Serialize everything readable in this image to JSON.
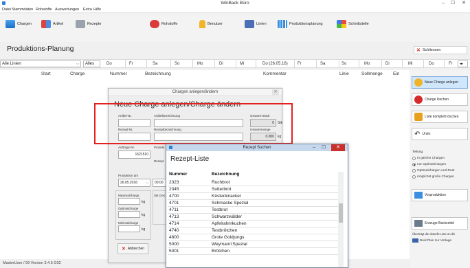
{
  "window": {
    "title": "WinBack Büro",
    "controls": [
      "–",
      "☐",
      "✕"
    ]
  },
  "menu": [
    "Datei",
    "Stammdaten",
    "Rohstoffe",
    "Auswertungen",
    "Extra",
    "Hilfe"
  ],
  "toolbar": [
    {
      "label": "Chargen",
      "icon": "chargen-icon"
    },
    {
      "label": "Artikel",
      "icon": "artikel-icon"
    },
    {
      "label": "Rezepte",
      "icon": "rezepte-icon"
    },
    {
      "label": "Rohstoffe",
      "icon": "rohstoffe-icon"
    },
    {
      "label": "Benutzer",
      "icon": "benutzer-icon"
    },
    {
      "label": "Linien",
      "icon": "linien-icon"
    },
    {
      "label": "Produktionsplanung",
      "icon": "produktionsplanung-icon"
    },
    {
      "label": "Schnittstelle",
      "icon": "schnittstelle-icon"
    }
  ],
  "page": {
    "title": "Produktions-Planung",
    "close_label": "Schliessen"
  },
  "filter": {
    "linien_select": "Alle Linien",
    "alles_label": "Alles",
    "days": [
      "Do",
      "Fr",
      "Sa",
      "So",
      "Mo",
      "Di",
      "Mi",
      "Do (26.05.16)",
      "Fr",
      "Sa",
      "So",
      "Mo",
      "Di",
      "Mi",
      "Do",
      "Fr"
    ]
  },
  "columns": [
    "Start",
    "Charge",
    "Nummer",
    "Bezeichnung",
    "Kommentar",
    "Linie",
    "Sollmenge",
    "Ein"
  ],
  "side": {
    "buttons": [
      "Neue Charge anlegen",
      "Charge löschen",
      "Liste komplett löschen",
      "Undo"
    ],
    "teilung_label": "Teilung",
    "radios": [
      "in gleiche Chargen",
      "nur Optimalchargen",
      "Optimalchargen und Rest",
      "möglichst große Chargen"
    ],
    "radio_selected": 1,
    "vorproduktion_label": "Vorproduktion",
    "backzettel_label": "Erzeuge Backzettel",
    "note_text": "Überträgt die aktuelle Liste an die",
    "bool_label": "Bool Plan zur Vorlage"
  },
  "status": {
    "text": "MasterUser / 99   Version 3.4.5 G02"
  },
  "dialog": {
    "title": "Chargen anlegen/ändern",
    "heading": "Neue Charge anlegen/Charge ändern",
    "artikel_nr_label": "Artikel-Nr.",
    "artikel_bez_label": "Artikelbezeichnung",
    "gesamt_stueck_label": "Gesamt-Stück",
    "gesamt_stueck_value": "0",
    "stk_unit": "Stk",
    "rezept_nr_label": "Rezept-Nr.",
    "rezept_bez_label": "Rezeptbezeichnung",
    "gesamtmenge_label": "Gesamtmenge",
    "gesamtmenge_value": "0.000",
    "kg_unit": "kg",
    "auftrags_nr_label": "Auftrags-Nr.",
    "auftrags_nr_value": "1621510",
    "produkt_label": "Produkt",
    "rezept_label": "Rezept",
    "produktion_am_label": "Produktion am",
    "produktion_am_value": "26.05.2016",
    "produktion_time_value": "00:00",
    "maximalcharge_label": "Maximalcharge",
    "optimalcharge_label": "Optimalcharge",
    "minimalcharge_label": "Minimalcharge",
    "stk_ges_label": "Stk.Ges",
    "abbrechen_label": "Abbrechen"
  },
  "popup": {
    "title": "Rezept Suchen",
    "heading": "Rezept-Liste",
    "columns": [
      "Nummer",
      "Bezeichnung"
    ],
    "rows": [
      [
        "2323",
        "Ruchbrot"
      ],
      [
        "2345",
        "Sutterbrot"
      ],
      [
        "4700",
        "Küstenknacker"
      ],
      [
        "4701",
        "Schmacke Spezial"
      ],
      [
        "4711",
        "Testbrot"
      ],
      [
        "4713",
        "Schwarzwälder"
      ],
      [
        "4714",
        "Apfelrahmkuchen"
      ],
      [
        "4740",
        "Testbrötchen"
      ],
      [
        "4800",
        "Grote Goldjungs"
      ],
      [
        "5000",
        "Weymann'Spezial"
      ],
      [
        "5001",
        "Brötchen"
      ]
    ]
  }
}
